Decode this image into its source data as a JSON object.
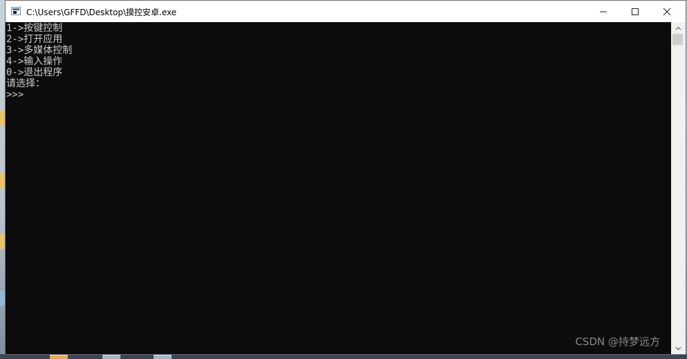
{
  "window": {
    "title": "C:\\Users\\GFFD\\Desktop\\摸控安卓.exe"
  },
  "console": {
    "lines": [
      "1->按键控制",
      "2->打开应用",
      "3->多媒体控制",
      "4->输入操作",
      "0->退出程序",
      "请选择：",
      ">>>"
    ],
    "background": "#0c0c0c",
    "foreground": "#cccccc"
  },
  "watermark": "CSDN @持梦远方"
}
